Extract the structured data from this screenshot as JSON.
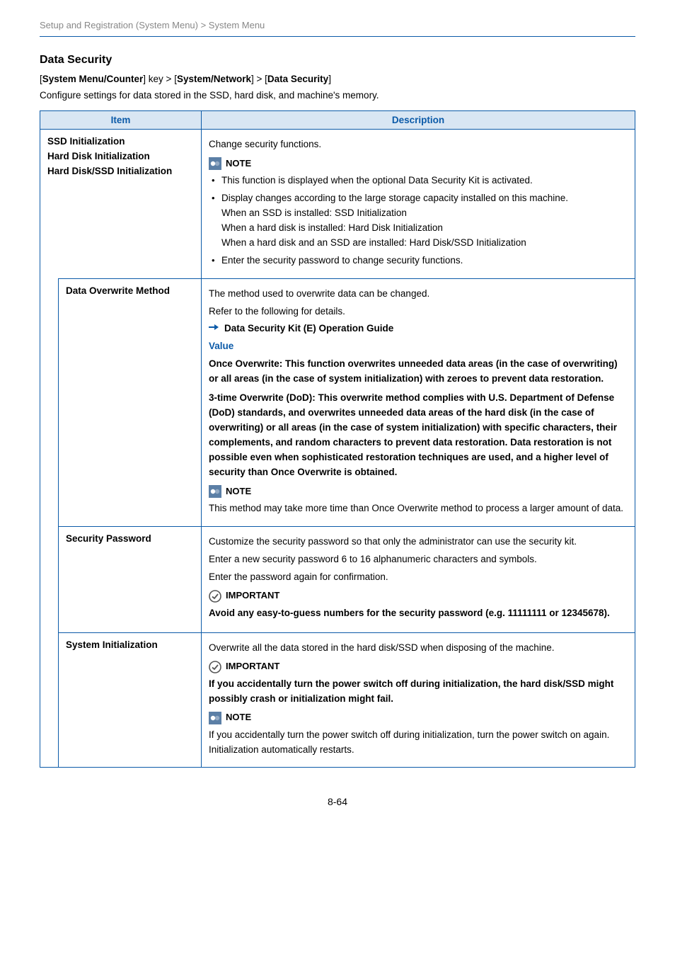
{
  "breadcrumb": "Setup and Registration (System Menu) > System Menu",
  "section_title": "Data Security",
  "nav_path": {
    "prefix": "[",
    "p1": "System Menu/Counter",
    "mid1": "] key > [",
    "p2": "System/Network",
    "mid2": "] > [",
    "p3": "Data Security",
    "suffix": "]"
  },
  "intro": "Configure settings for data stored in the SSD, hard disk, and machine's memory.",
  "headers": {
    "item": "Item",
    "description": "Description"
  },
  "labels": {
    "note": "NOTE",
    "important": "IMPORTANT",
    "value": "Value"
  },
  "rows": {
    "r1": {
      "item1": "SSD Initialization",
      "item2": "Hard Disk Initialization",
      "item3": "Hard Disk/SSD Initialization",
      "desc_lead": "Change security functions.",
      "b1": "This function is displayed when the optional Data Security Kit is activated.",
      "b2": "Display changes according to the large storage capacity installed on this machine.",
      "b2a": "When an SSD is installed: SSD Initialization",
      "b2b": "When a hard disk is installed: Hard Disk Initialization",
      "b2c": "When a hard disk and an SSD are installed: Hard Disk/SSD Initialization",
      "b3": "Enter the security password to change security functions."
    },
    "r2": {
      "item1": "Data Overwrite Method",
      "p1": "The method used to overwrite data can be changed.",
      "p2": "Refer to the following for details.",
      "ref": "Data Security Kit (E) Operation Guide",
      "v1": "Once Overwrite: This function overwrites unneeded data areas (in the case of overwriting) or all areas (in the case of system initialization) with zeroes to prevent data restoration.",
      "v2": "3-time Overwrite (DoD): This overwrite method complies with U.S. Department of Defense (DoD) standards, and overwrites unneeded data areas of the hard disk (in the case of overwriting) or all areas (in the case of system initialization) with specific characters, their complements, and random characters to prevent data restoration. Data restoration is not possible even when sophisticated restoration techniques are used, and a higher level of security than Once Overwrite is obtained.",
      "note": "This method may take more time than Once Overwrite method to process a larger amount of data."
    },
    "r3": {
      "item": "Security Password",
      "p1": "Customize the security password so that only the administrator can use the security kit.",
      "p2": "Enter a new security password 6 to 16 alphanumeric characters and symbols.",
      "p3": "Enter the password again for confirmation.",
      "imp": "Avoid any easy-to-guess numbers for the security password (e.g. 11111111 or 12345678)."
    },
    "r4": {
      "item": "System Initialization",
      "p1": "Overwrite all the data stored in the hard disk/SSD when disposing of the machine.",
      "imp": "If you accidentally turn the power switch off during initialization, the hard disk/SSD might possibly crash or initialization might fail.",
      "note": "If you accidentally turn the power switch off during initialization, turn the power switch on again. Initialization automatically restarts."
    }
  },
  "pagenum": "8-64"
}
